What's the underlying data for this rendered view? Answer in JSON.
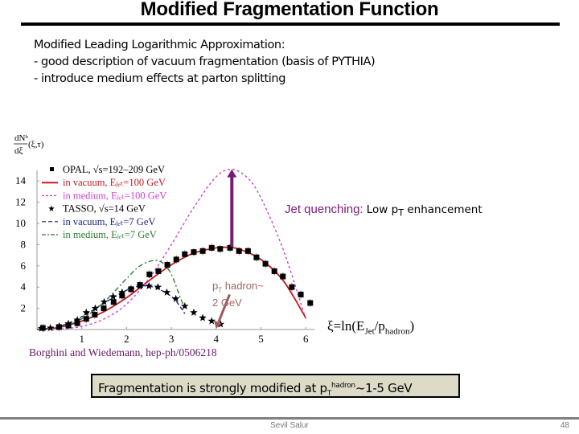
{
  "slide": {
    "title": "Modified Fragmentation Function",
    "intro_lines": [
      "Modified Leading Logarithmic Approximation:",
      "- good description of vacuum fragmentation (basis of PYTHIA)",
      "- introduce medium effects at parton splitting"
    ],
    "jet_quenching_label": "Jet quenching:",
    "low_pt_label_pre": "Low p",
    "low_pt_label_sub": "T",
    "low_pt_label_post": " enhancement",
    "pt_hadron_label_pre": "p",
    "pt_hadron_label_sub": "T",
    "pt_hadron_label_post": " hadron~",
    "pt_hadron_label_line2": "2 GeV",
    "xi_label_pre": "ξ=ln(E",
    "xi_label_sub1": "Jet",
    "xi_label_mid": "/p",
    "xi_label_sub2": "hadron",
    "xi_label_post": ")",
    "reference": "Borghini and Wiedemann, hep-ph/0506218",
    "conclusion_pre": "Fragmentation is strongly modified at p",
    "conclusion_sub": "T",
    "conclusion_sup": "hadron",
    "conclusion_post": "~1-5 GeV",
    "footer_author": "Sevil Salur",
    "footer_page": "48"
  },
  "colors": {
    "vacuum_100": "#c8161e",
    "medium_100": "#d040d0",
    "vacuum_7": "#1a237e",
    "medium_7": "#2e7d32",
    "arrow": "#7a1a78",
    "pt_arrow": "#a05a5a"
  },
  "chart_data": {
    "type": "scatter",
    "title": "",
    "ylabel": "dN^h/dξ (ξ,τ)",
    "xlabel": "ξ=ln(E_Jet/p_hadron)",
    "xlim": [
      0,
      6.2
    ],
    "ylim": [
      0,
      15
    ],
    "xticks": [
      1,
      2,
      3,
      4,
      5,
      6
    ],
    "yticks": [
      2,
      4,
      6,
      8,
      10,
      12,
      14
    ],
    "grid": false,
    "legend_position": "top-left",
    "legend": [
      {
        "name": "OPAL, √s=192–209 GeV",
        "style": "square-marker"
      },
      {
        "name": "in vacuum, E_jet=100 GeV",
        "style": "solid",
        "color": "#c8161e"
      },
      {
        "name": "in medium, E_jet=100 GeV",
        "style": "dotted",
        "color": "#d040d0"
      },
      {
        "name": "TASSO, √s=14 GeV",
        "style": "star-marker"
      },
      {
        "name": "in vacuum, E_jet=7 GeV",
        "style": "dashed",
        "color": "#1a237e"
      },
      {
        "name": "in medium, E_jet=7 GeV",
        "style": "dash-dot",
        "color": "#2e7d32"
      }
    ],
    "series": [
      {
        "name": "OPAL, √s=192–209 GeV",
        "kind": "points",
        "marker": "square",
        "x": [
          0.13,
          0.49,
          0.7,
          0.9,
          1.1,
          1.29,
          1.49,
          1.71,
          1.9,
          2.1,
          2.3,
          2.51,
          2.71,
          2.91,
          3.11,
          3.3,
          3.5,
          3.7,
          3.9,
          4.09,
          4.31,
          4.51,
          4.71,
          4.9,
          5.1,
          5.3,
          5.49,
          5.69,
          5.89,
          6.1
        ],
        "y": [
          0.15,
          0.23,
          0.38,
          0.6,
          1.0,
          1.4,
          2.0,
          2.6,
          3.2,
          3.8,
          4.2,
          5.2,
          5.5,
          6.1,
          6.6,
          7.1,
          7.3,
          7.4,
          7.7,
          7.6,
          7.7,
          7.4,
          7.4,
          6.8,
          6.2,
          5.5,
          5.0,
          4.0,
          3.3,
          2.5
        ]
      },
      {
        "name": "TASSO, √s=14 GeV",
        "kind": "points",
        "marker": "star",
        "x": [
          0.1,
          0.3,
          0.5,
          0.7,
          0.9,
          1.1,
          1.3,
          1.5,
          1.7,
          1.9,
          2.1,
          2.3,
          2.5,
          2.7,
          2.9,
          3.1,
          3.3,
          3.5,
          3.7,
          3.9,
          4.1
        ],
        "y": [
          0.1,
          0.15,
          0.3,
          0.55,
          0.9,
          1.6,
          2.0,
          2.6,
          3.1,
          3.5,
          3.8,
          4.1,
          4.1,
          4.0,
          3.5,
          2.9,
          2.2,
          1.6,
          1.1,
          0.8,
          0.5
        ]
      },
      {
        "name": "in vacuum, E_jet=100 GeV",
        "kind": "line",
        "x": [
          0,
          0.5,
          1.0,
          1.5,
          2.0,
          2.5,
          3.0,
          3.5,
          4.0,
          4.2,
          4.5,
          5.0,
          5.5,
          6.0
        ],
        "y": [
          0,
          0.2,
          0.8,
          1.7,
          3.0,
          4.6,
          6.1,
          7.2,
          7.7,
          7.75,
          7.6,
          6.6,
          4.6,
          1.1
        ]
      },
      {
        "name": "in medium, E_jet=100 GeV",
        "kind": "line",
        "x": [
          0,
          0.5,
          1.0,
          1.5,
          2.0,
          2.5,
          3.0,
          3.5,
          4.0,
          4.35,
          4.7,
          5.0,
          5.5,
          6.0
        ],
        "y": [
          0,
          0.05,
          0.3,
          1.0,
          2.4,
          4.8,
          8.0,
          11.5,
          14.4,
          15.1,
          14.3,
          12.4,
          7.5,
          1.0
        ]
      },
      {
        "name": "in vacuum, E_jet=7 GeV",
        "kind": "line",
        "x": [
          0,
          0.5,
          1.0,
          1.5,
          2.0,
          2.3,
          2.6,
          2.9,
          3.1,
          3.3
        ],
        "y": [
          0,
          0.3,
          1.2,
          2.5,
          3.7,
          4.1,
          4.0,
          3.4,
          2.7,
          1.5
        ]
      },
      {
        "name": "in medium, E_jet=7 GeV",
        "kind": "line",
        "x": [
          0,
          0.5,
          1.0,
          1.5,
          2.0,
          2.3,
          2.6,
          2.8,
          3.0,
          3.2,
          3.3
        ],
        "y": [
          0,
          0.2,
          1.0,
          2.6,
          4.8,
          6.0,
          6.5,
          6.3,
          5.2,
          3.0,
          2.0
        ]
      }
    ],
    "annotations": [
      {
        "text": "Jet quenching: Low pT enhancement",
        "type": "arrow",
        "from": [
          4.35,
          7.8
        ],
        "to": [
          4.35,
          15.1
        ]
      },
      {
        "text": "pT hadron~ 2 GeV",
        "type": "arrow",
        "from": [
          4.3,
          3.3
        ],
        "to": [
          4.0,
          0.1
        ]
      }
    ]
  }
}
